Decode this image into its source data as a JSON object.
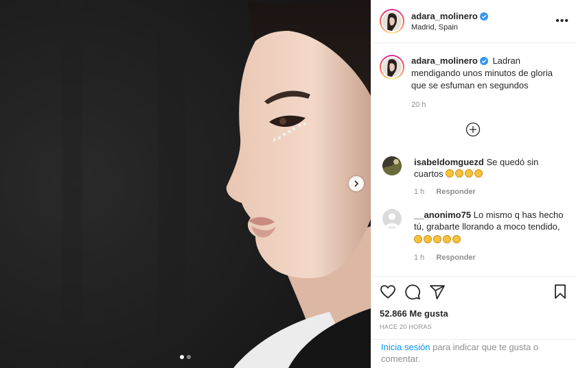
{
  "post": {
    "username": "adara_molinero",
    "location": "Madrid, Spain",
    "more_label": "•••",
    "caption": {
      "username": "adara_molinero",
      "text": "Ladran mendigando unos minutos de gloria que se esfuman en segundos",
      "time": "20 h"
    },
    "comments": [
      {
        "username": "isabeldomguezd",
        "text": "Se quedó sin cuartos",
        "emoji_count": 4,
        "time": "1 h",
        "reply_label": "Responder"
      },
      {
        "username": "__anonimo75",
        "text": "Lo mismo q has hecho tú, grabarte llorando a moco tendido,",
        "emoji_count": 5,
        "time": "1 h",
        "reply_label": "Responder"
      }
    ],
    "likes": "52.866 Me gusta",
    "timestamp": "HACE 20 HORAS",
    "login_link": "Inicia sesión",
    "login_text": " para indicar que te gusta o comentar.",
    "carousel": {
      "slides": 2,
      "active": 0
    }
  },
  "colors": {
    "link": "#0095f6",
    "verified": "#3897f0",
    "muted": "#8e8e8e"
  },
  "icons": [
    "next-arrow-icon",
    "verified-icon",
    "add-circle-icon",
    "heart-icon",
    "comment-icon",
    "share-icon",
    "bookmark-icon",
    "more-options-icon"
  ]
}
